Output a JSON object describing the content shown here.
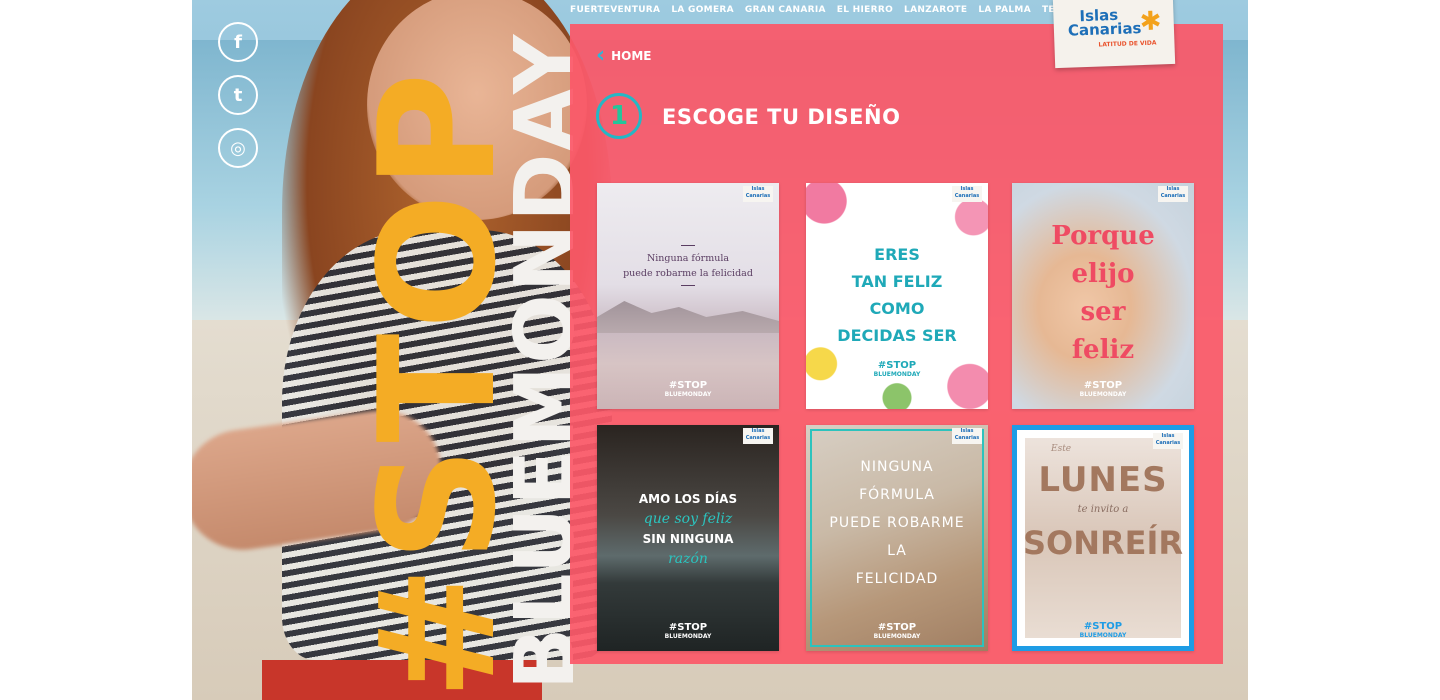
{
  "topnav": [
    "FUERTEVENTURA",
    "LA GOMERA",
    "GRAN CANARIA",
    "EL HIERRO",
    "LANZAROTE",
    "LA PALMA",
    "TENERIFE"
  ],
  "social": {
    "facebook": "f",
    "twitter": "t",
    "instagram": "◎"
  },
  "hero": {
    "hashtag": "#STOP",
    "subtitle": "BLUEMONDAY"
  },
  "logo": {
    "line1": "Islas",
    "line2": "Canarias",
    "tagline": "LATITUD DE VIDA"
  },
  "nav": {
    "home_label": "HOME"
  },
  "step": {
    "number": "1",
    "title": "ESCOGE TU DISEÑO"
  },
  "designs": [
    {
      "quote_l1": "Ninguna fórmula",
      "quote_l2": "puede robarme la felicidad"
    },
    {
      "quote_l1": "ERES",
      "quote_l2": "TAN FELIZ",
      "quote_l3": "COMO",
      "quote_l4": "DECIDAS SER"
    },
    {
      "quote_l1": "Porque",
      "quote_l2": "elijo",
      "quote_l3": "ser",
      "quote_l4": "feliz"
    },
    {
      "quote_l1": "AMO LOS DÍAS",
      "quote_l2": "que soy feliz",
      "quote_l3": "SIN NINGUNA",
      "quote_l4": "razón"
    },
    {
      "quote_l1": "NINGUNA",
      "quote_l2": "FÓRMULA",
      "quote_l3": "PUEDE ROBARME",
      "quote_l4": "LA",
      "quote_l5": "FELICIDAD"
    },
    {
      "pre": "Este",
      "big1": "LUNES",
      "mid": "te invito a",
      "big2": "SONREÍR"
    }
  ],
  "card_tag": {
    "l1": "#STOP",
    "l2": "BLUEMONDAY"
  },
  "card_logo": {
    "l1": "Islas",
    "l2": "Canarias"
  },
  "colors": {
    "panel": "#fb5868",
    "accent_yellow": "#f4ac25",
    "teal": "#25b7c5",
    "blue_frame": "#1e9ce5"
  }
}
